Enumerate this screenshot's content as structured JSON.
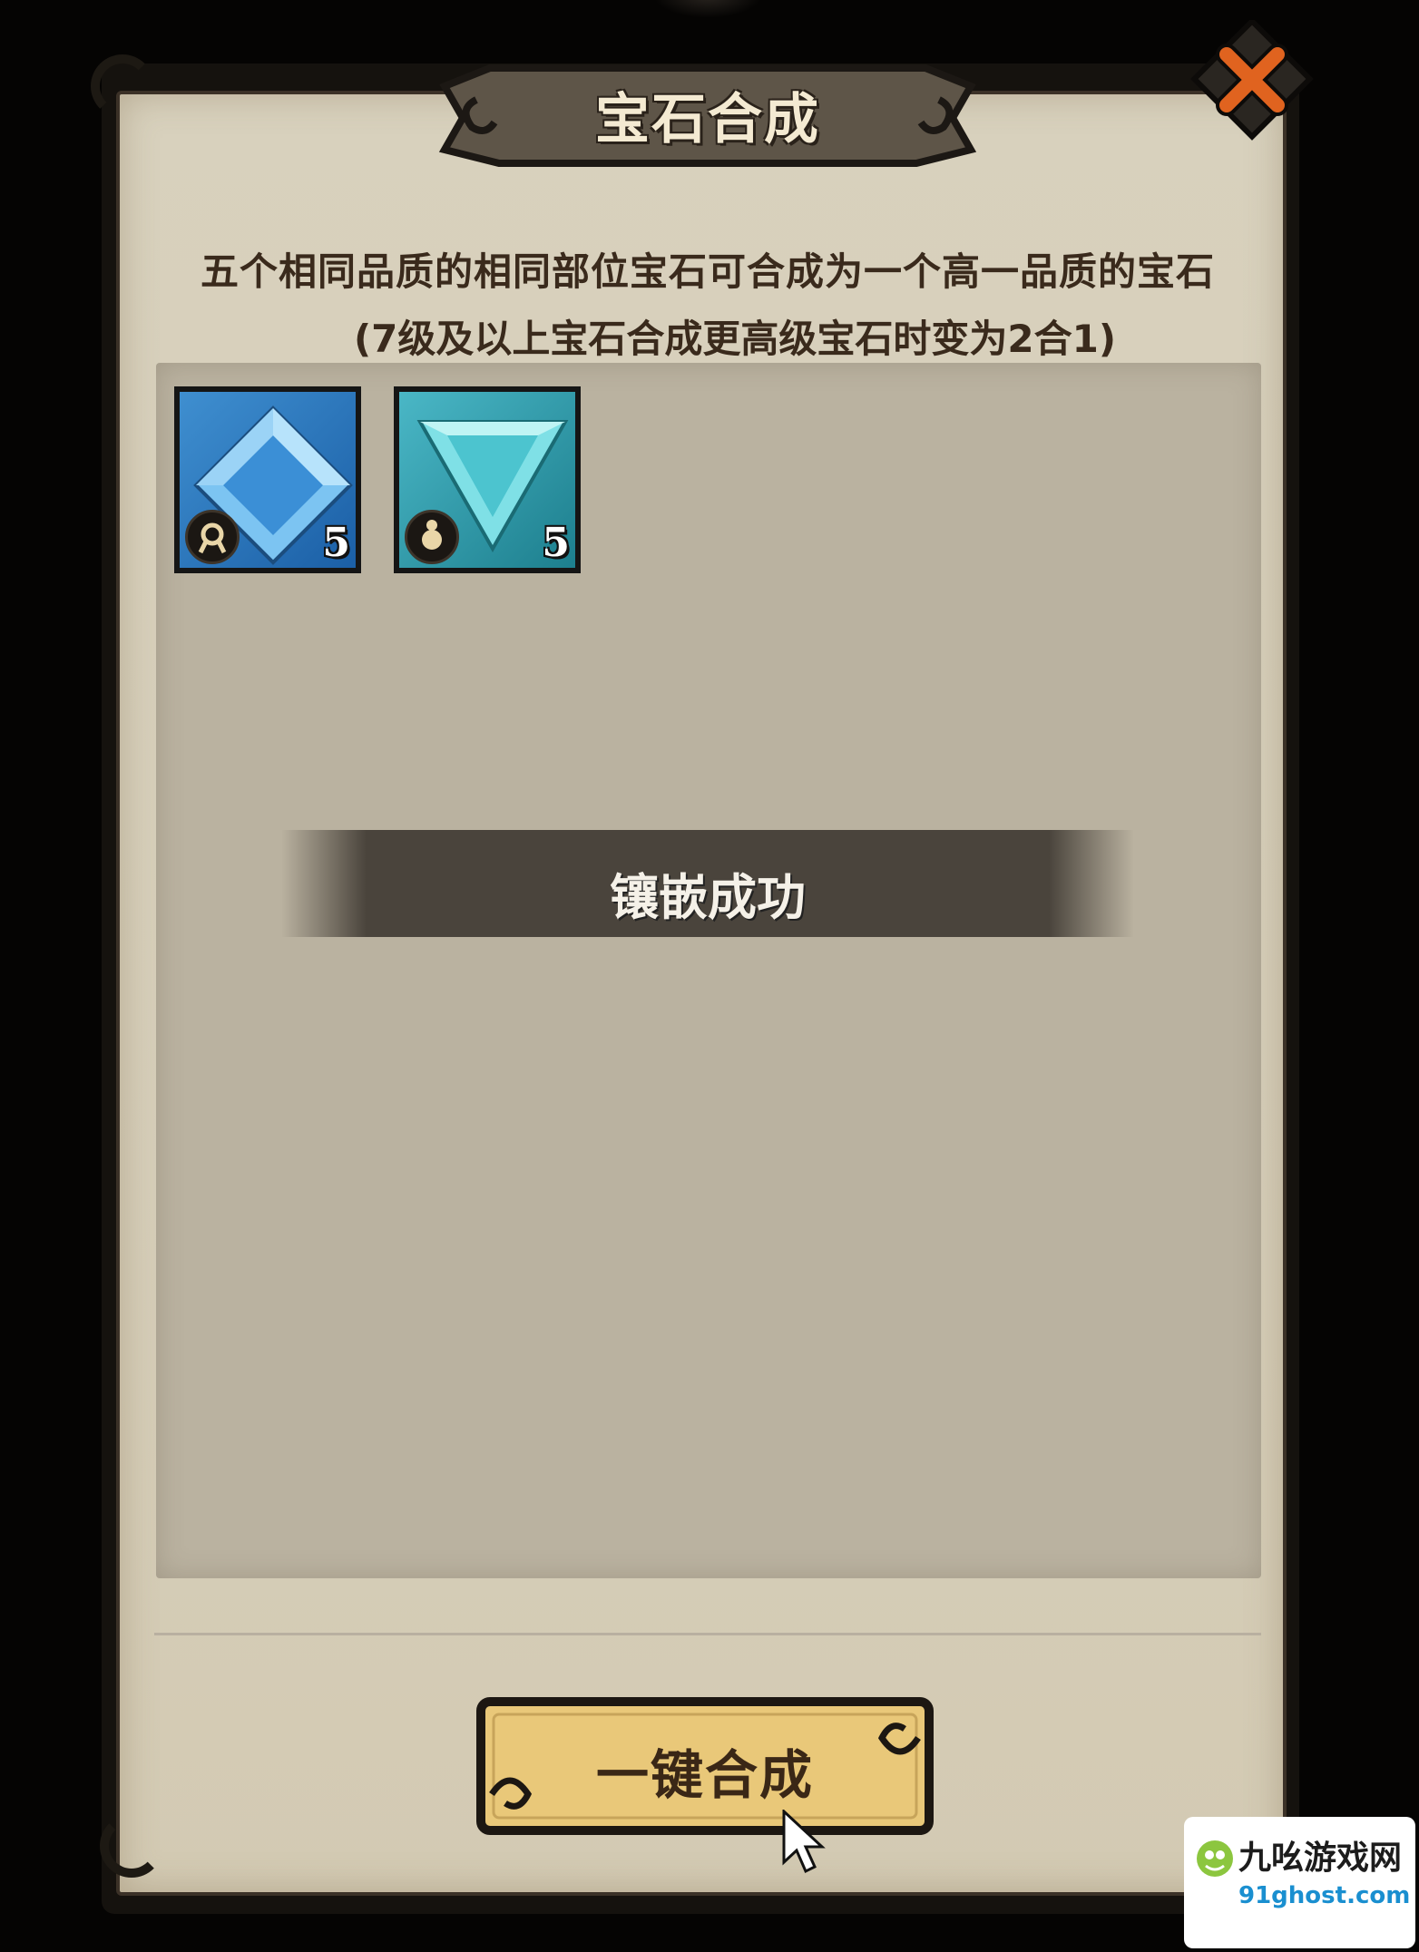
{
  "dialog": {
    "title": "宝石合成",
    "description_line1": "五个相同品质的相同部位宝石可合成为一个高一品质的宝石",
    "description_line2": "(7级及以上宝石合成更高级宝石时变为2合1)"
  },
  "gems": [
    {
      "color": "#2e7fc9",
      "shape": "square-gem",
      "part_icon": "amulet-icon",
      "count": "5"
    },
    {
      "color": "#3bb0bf",
      "shape": "triangle-gem",
      "part_icon": "ring-icon",
      "count": "5"
    }
  ],
  "toast": {
    "message": "镶嵌成功"
  },
  "actions": {
    "synthesize_all_label": "一键合成"
  },
  "icons": {
    "close": "close-icon",
    "cursor": "mouse-pointer-icon"
  },
  "watermark": {
    "title": "九吆游戏网",
    "url": "91ghost.com"
  },
  "colors": {
    "panel_parchment": "#d8d1bd",
    "grid_area": "#bab2a0",
    "close_x": "#e0631f",
    "button_gold": "#e9c879",
    "toast_bg": "#4a443c"
  }
}
